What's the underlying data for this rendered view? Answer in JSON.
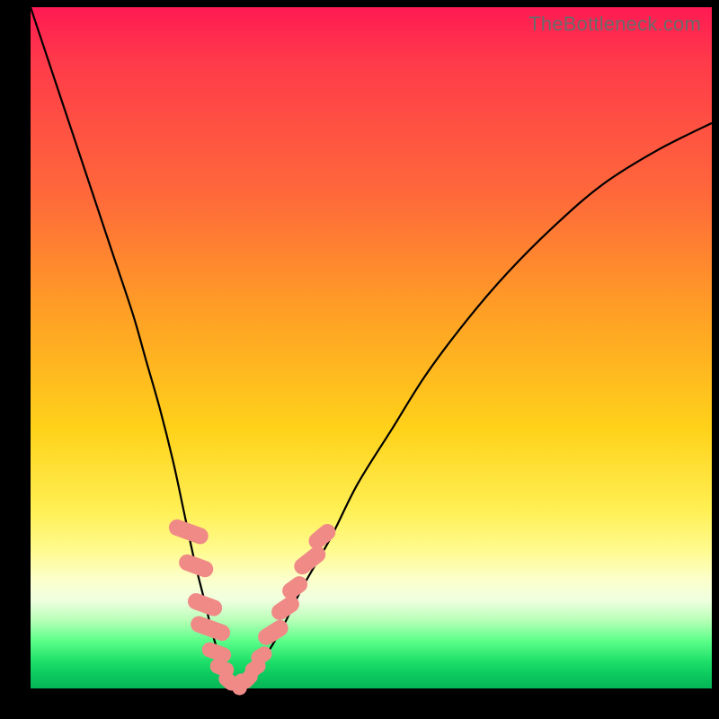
{
  "watermark": "TheBottleneck.com",
  "colors": {
    "curve": "#000000",
    "marker_fill": "#f08a87",
    "marker_stroke": "#f08a87"
  },
  "chart_data": {
    "type": "line",
    "title": "",
    "xlabel": "",
    "ylabel": "",
    "xlim": [
      0,
      100
    ],
    "ylim": [
      0,
      100
    ],
    "grid": false,
    "legend": false,
    "series": [
      {
        "name": "bottleneck-curve",
        "x": [
          0,
          3,
          6,
          9,
          12,
          15,
          17,
          19,
          21,
          22.5,
          24,
          25.5,
          27,
          28.5,
          29.5,
          30.5,
          32,
          34,
          37,
          40,
          44,
          48,
          53,
          58,
          64,
          70,
          77,
          84,
          92,
          100
        ],
        "values": [
          100,
          91,
          82,
          73,
          64,
          55,
          48,
          41,
          33,
          26,
          19,
          13,
          7,
          3,
          1.2,
          0.5,
          1.5,
          4,
          9,
          15,
          22,
          30,
          38,
          46,
          54,
          61,
          68,
          74,
          79,
          83
        ]
      }
    ],
    "minimum": {
      "x": 30.2,
      "value": 0.4
    },
    "markers": [
      {
        "x": 23.2,
        "value": 23.0,
        "rx": 1.2,
        "ry": 3.0,
        "rot": -70
      },
      {
        "x": 24.3,
        "value": 18.0,
        "rx": 1.2,
        "ry": 2.6,
        "rot": -70
      },
      {
        "x": 25.6,
        "value": 12.3,
        "rx": 1.2,
        "ry": 2.6,
        "rot": -70
      },
      {
        "x": 26.4,
        "value": 8.8,
        "rx": 1.2,
        "ry": 3.0,
        "rot": -70
      },
      {
        "x": 27.3,
        "value": 5.3,
        "rx": 1.1,
        "ry": 2.2,
        "rot": -70
      },
      {
        "x": 28.1,
        "value": 3.0,
        "rx": 1.1,
        "ry": 1.8,
        "rot": -68
      },
      {
        "x": 29.1,
        "value": 1.1,
        "rx": 1.1,
        "ry": 1.6,
        "rot": -50
      },
      {
        "x": 30.8,
        "value": 0.6,
        "rx": 1.1,
        "ry": 1.6,
        "rot": 15
      },
      {
        "x": 31.9,
        "value": 1.4,
        "rx": 1.1,
        "ry": 1.6,
        "rot": 45
      },
      {
        "x": 33.0,
        "value": 3.0,
        "rx": 1.1,
        "ry": 1.6,
        "rot": 55
      },
      {
        "x": 33.9,
        "value": 4.8,
        "rx": 1.1,
        "ry": 1.6,
        "rot": 58
      },
      {
        "x": 35.6,
        "value": 8.2,
        "rx": 1.2,
        "ry": 2.4,
        "rot": 58
      },
      {
        "x": 37.4,
        "value": 11.8,
        "rx": 1.2,
        "ry": 2.2,
        "rot": 56
      },
      {
        "x": 38.8,
        "value": 14.8,
        "rx": 1.2,
        "ry": 2.0,
        "rot": 54
      },
      {
        "x": 41.0,
        "value": 18.8,
        "rx": 1.2,
        "ry": 2.6,
        "rot": 52
      },
      {
        "x": 42.8,
        "value": 22.3,
        "rx": 1.2,
        "ry": 2.2,
        "rot": 50
      }
    ]
  }
}
